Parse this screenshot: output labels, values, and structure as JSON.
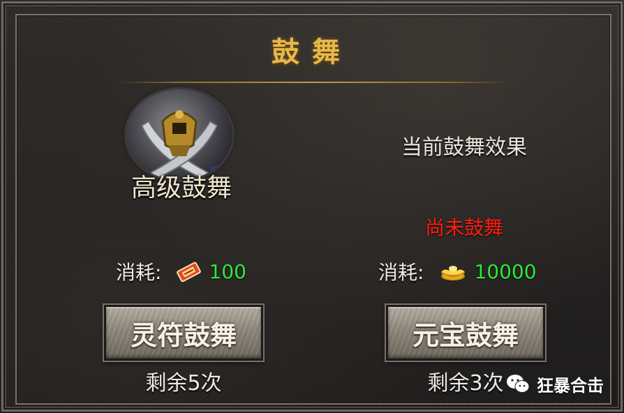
{
  "window": {
    "title": "鼓舞"
  },
  "emblem": {
    "label": "高级鼓舞",
    "icon": "crossed-swords-helmet-icon"
  },
  "effect": {
    "title": "当前鼓舞效果",
    "status": "尚未鼓舞",
    "status_color": "#ff1e10"
  },
  "left_option": {
    "cost_label": "消耗:",
    "cost_icon": "talisman-icon",
    "cost_value": "100",
    "button_label": "灵符鼓舞",
    "remaining": "剩余5次"
  },
  "right_option": {
    "cost_label": "消耗:",
    "cost_icon": "gold-ingot-icon",
    "cost_value": "10000",
    "button_label": "元宝鼓舞",
    "remaining": "剩余3次"
  },
  "watermark": {
    "text": "狂暴合击",
    "icon": "wechat-icon"
  },
  "colors": {
    "accent_gold": "#e6b84a",
    "cost_green": "#2ee83a"
  }
}
